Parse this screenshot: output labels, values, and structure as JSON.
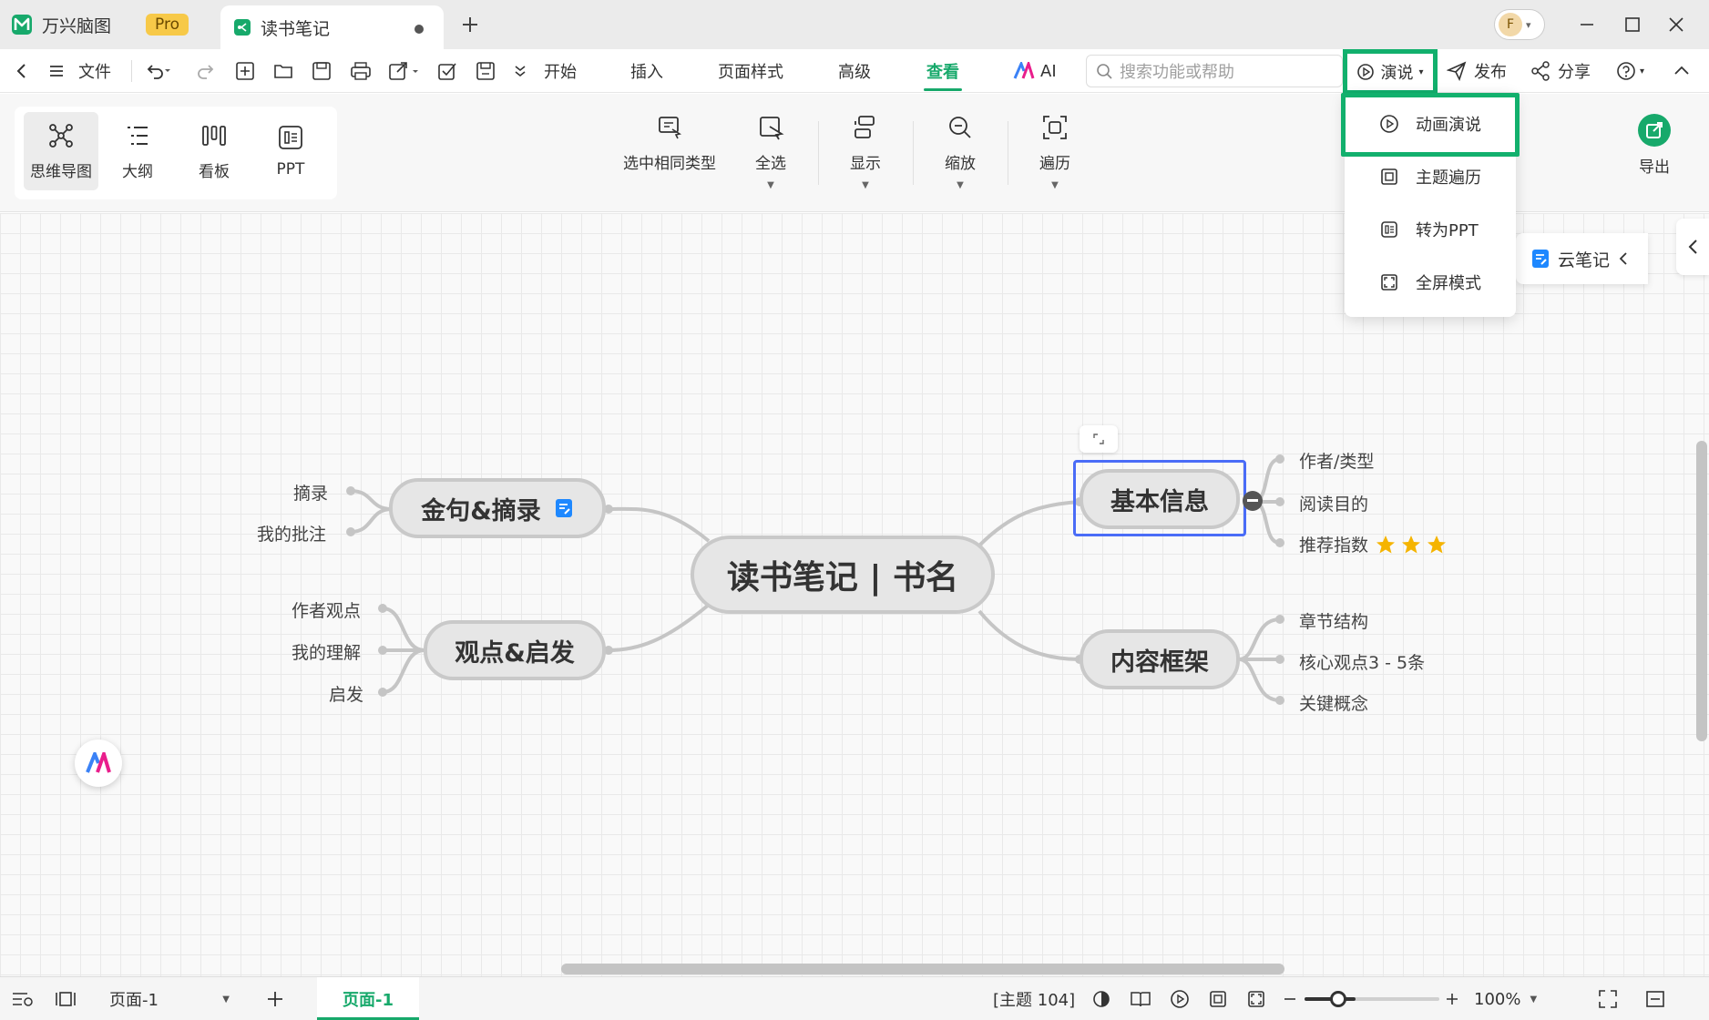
{
  "app": {
    "name": "万兴脑图",
    "badge": "Pro"
  },
  "document_tab": {
    "title": "读书笔记"
  },
  "menubar": {
    "file_label": "文件",
    "tabs": [
      "开始",
      "插入",
      "页面样式",
      "高级",
      "查看"
    ],
    "active_tab": "查看",
    "ai_label": "AI",
    "search_placeholder": "搜索功能或帮助",
    "present_label": "演说",
    "publish_label": "发布",
    "share_label": "分享"
  },
  "ribbon": {
    "views": [
      {
        "label": "思维导图",
        "icon": "mindmap-icon"
      },
      {
        "label": "大纲",
        "icon": "outline-icon"
      },
      {
        "label": "看板",
        "icon": "kanban-icon"
      },
      {
        "label": "PPT",
        "icon": "ppt-icon"
      }
    ],
    "tools": [
      {
        "label": "选中相同类型",
        "icon": "select-same-type-icon"
      },
      {
        "label": "全选",
        "icon": "select-all-icon"
      },
      {
        "label": "显示",
        "icon": "display-icon"
      },
      {
        "label": "缩放",
        "icon": "zoom-icon"
      },
      {
        "label": "遍历",
        "icon": "traverse-icon"
      }
    ],
    "export_label": "导出"
  },
  "dropdown": {
    "items": [
      {
        "label": "动画演说",
        "icon": "play-circle-icon"
      },
      {
        "label": "主题遍历",
        "icon": "topic-traverse-icon"
      },
      {
        "label": "转为PPT",
        "icon": "convert-ppt-icon"
      },
      {
        "label": "全屏模式",
        "icon": "fullscreen-icon"
      }
    ]
  },
  "cloud_note": {
    "label": "云笔记"
  },
  "mindmap": {
    "central": "读书笔记 | 书名",
    "branches": [
      {
        "title": "金句&摘录",
        "children": [
          "摘录",
          "我的批注"
        ],
        "has_note": true
      },
      {
        "title": "观点&启发",
        "children": [
          "作者观点",
          "我的理解",
          "启发"
        ]
      },
      {
        "title": "基本信息",
        "children": [
          "作者/类型",
          "阅读目的",
          "推荐指数"
        ],
        "rating_stars": 3,
        "selected": true
      },
      {
        "title": "内容框架",
        "children": [
          "章节结构",
          "核心观点3 - 5条",
          "关键概念"
        ]
      }
    ]
  },
  "statusbar": {
    "page_select": "页面-1",
    "page_tab": "页面-1",
    "topic_count": "[主题 104]",
    "zoom": "100%"
  },
  "colors": {
    "accent": "#17a96b",
    "highlight": "#12b06d",
    "selection": "#4a6cf7",
    "star": "#f5b400"
  }
}
